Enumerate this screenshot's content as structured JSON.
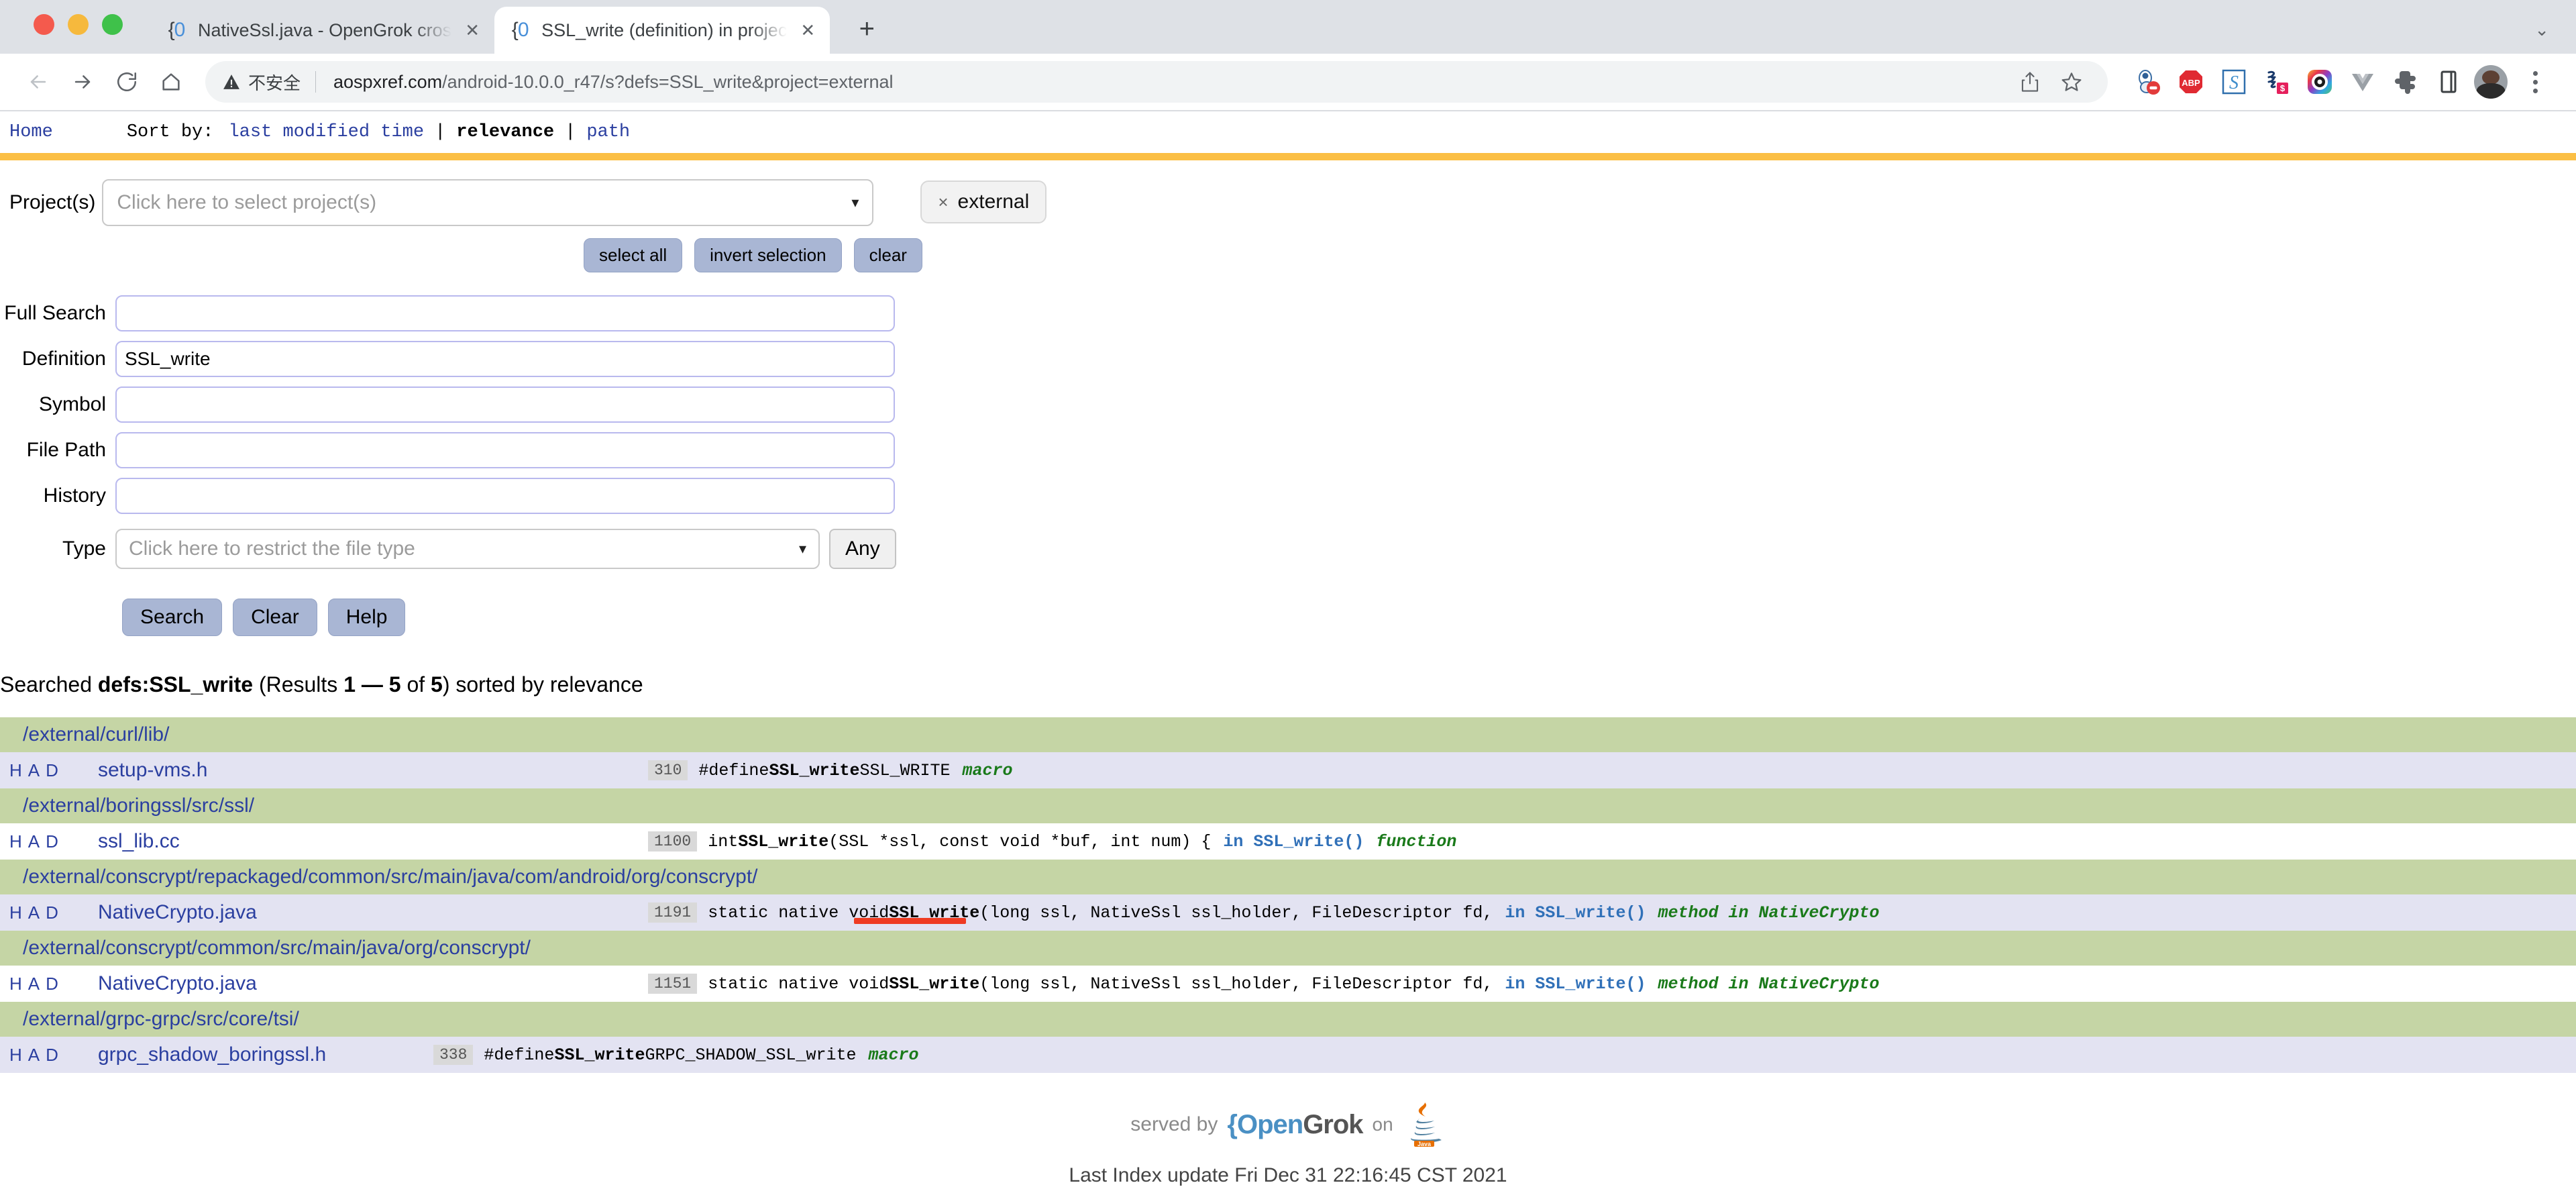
{
  "browser": {
    "window_controls": [
      "close",
      "minimize",
      "maximize"
    ],
    "tabs": [
      {
        "title": "NativeSsl.java - OpenGrok cros",
        "favicon": "opengrok-favicon",
        "active": false,
        "close_label": "✕"
      },
      {
        "title": "SSL_write (definition) in projec",
        "favicon": "opengrok-favicon",
        "active": true,
        "close_label": "✕"
      }
    ],
    "new_tab_label": "+",
    "tab_list_chevron": "⌄",
    "toolbar": {
      "back_label": "←",
      "forward_label": "→",
      "reload_label": "↻",
      "home_label": "⌂",
      "security_text": "不安全",
      "url_host": "aospxref.com",
      "url_path": "/android-10.0.0_r47/s?defs=SSL_write&project=external",
      "share_label": "share-icon",
      "bookmark_label": "☆",
      "extensions": [
        "privacy-badger-icon",
        "adblock-plus-icon",
        "s-extension-icon",
        "honey-extension-icon",
        "colorful-circle-icon",
        "vue-devtools-icon",
        "puzzle-extensions-icon",
        "side-panel-icon"
      ],
      "avatar_label": "user-avatar",
      "menu_label": "chrome-menu"
    }
  },
  "opengrok": {
    "header": {
      "home_label": "Home",
      "sort_by_label": "Sort by:",
      "sort_options": [
        "last modified time",
        "relevance",
        "path"
      ],
      "sort_current": "relevance",
      "separator": "|"
    },
    "project_selector": {
      "label": "Project(s)",
      "placeholder": "Click here to select project(s)",
      "value": "",
      "caret": "▾",
      "selected_chip": {
        "remove_label": "×",
        "label": "external"
      },
      "buttons": [
        "select all",
        "invert selection",
        "clear"
      ]
    },
    "fields": [
      {
        "label": "Full Search",
        "value": "",
        "name": "full-search"
      },
      {
        "label": "Definition",
        "value": "SSL_write",
        "name": "definition"
      },
      {
        "label": "Symbol",
        "value": "",
        "name": "symbol"
      },
      {
        "label": "File Path",
        "value": "",
        "name": "file-path"
      },
      {
        "label": "History",
        "value": "",
        "name": "history"
      }
    ],
    "type_row": {
      "label": "Type",
      "placeholder": "Click here to restrict the file type",
      "caret": "▾",
      "any_button": "Any"
    },
    "actions": [
      "Search",
      "Clear",
      "Help"
    ],
    "searched_summary": {
      "prefix": "Searched ",
      "query": "defs:SSL_write",
      "results_open": " (Results ",
      "range": "1 — 5",
      "of": " of ",
      "total": "5",
      "suffix": ") sorted by relevance"
    },
    "results": [
      {
        "directory": "/external/curl/lib/",
        "rows": [
          {
            "had": [
              "H",
              "A",
              "D"
            ],
            "file": "setup-vms.h",
            "lineno": "310",
            "code_pre": "#define ",
            "code_match": "SSL_write",
            "code_post": " SSL_WRITE",
            "in_ref": "",
            "kind": "macro",
            "shaded": true,
            "annotated": false
          }
        ]
      },
      {
        "directory": "/external/boringssl/src/ssl/",
        "rows": [
          {
            "had": [
              "H",
              "A",
              "D"
            ],
            "file": "ssl_lib.cc",
            "lineno": "1100",
            "code_pre": "int ",
            "code_match": "SSL_write",
            "code_post": "(SSL *ssl, const void *buf, int num) {",
            "in_ref": "in SSL_write()",
            "kind": "function",
            "shaded": false,
            "annotated": false
          }
        ]
      },
      {
        "directory": "/external/conscrypt/repackaged/common/src/main/java/com/android/org/conscrypt/",
        "rows": [
          {
            "had": [
              "H",
              "A",
              "D"
            ],
            "file": "NativeCrypto.java",
            "lineno": "1191",
            "code_pre": "static native void ",
            "code_match": "SSL_write",
            "code_post": "(long ssl, NativeSsl ssl_holder, FileDescriptor fd,",
            "in_ref": "in SSL_write()",
            "kind": "method in NativeCrypto",
            "shaded": true,
            "annotated": true
          }
        ]
      },
      {
        "directory": "/external/conscrypt/common/src/main/java/org/conscrypt/",
        "rows": [
          {
            "had": [
              "H",
              "A",
              "D"
            ],
            "file": "NativeCrypto.java",
            "lineno": "1151",
            "code_pre": "static native void ",
            "code_match": "SSL_write",
            "code_post": "(long ssl, NativeSsl ssl_holder, FileDescriptor fd,",
            "in_ref": "in SSL_write()",
            "kind": "method in NativeCrypto",
            "shaded": false,
            "annotated": false
          }
        ]
      },
      {
        "directory": "/external/grpc-grpc/src/core/tsi/",
        "rows": [
          {
            "had": [
              "H",
              "A",
              "D"
            ],
            "file": "grpc_shadow_boringssl.h",
            "lineno": "338",
            "code_pre": "#define ",
            "code_match": "SSL_write",
            "code_post": " GRPC_SHADOW_SSL_write",
            "in_ref": "",
            "kind": "macro",
            "shaded": true,
            "annotated": false
          }
        ]
      }
    ],
    "footer": {
      "served_by": "served by",
      "logo_brace": "{",
      "logo_open": "Open",
      "logo_grok": "Grok",
      "on": "on",
      "java_label": "Java",
      "last_index": "Last Index update Fri Dec 31 22:16:45 CST 2021"
    }
  },
  "colors": {
    "orange_bar": "#fbbf45",
    "dir_row_bg": "#c5d5a5",
    "file_row_shaded_bg": "#e3e3f2",
    "link_blue": "#2b3fa0",
    "kind_green": "#1a7a1a",
    "in_ref_blue": "#3070b8",
    "button_bg": "#a9b6d4",
    "annotation_red": "#ef3b22"
  }
}
